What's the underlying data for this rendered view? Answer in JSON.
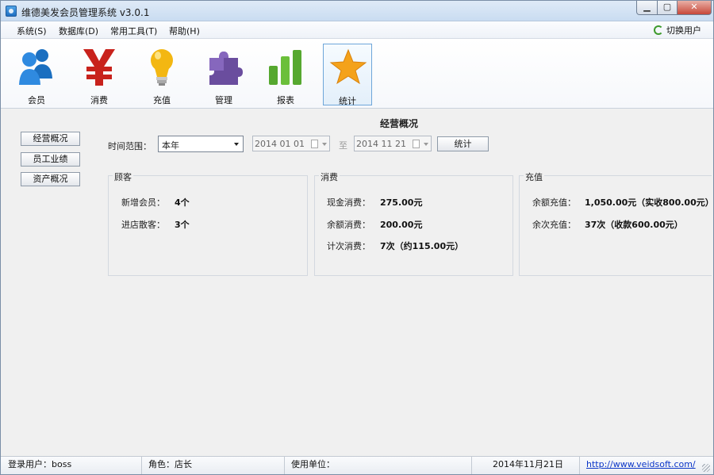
{
  "window": {
    "title": "维德美发会员管理系统 v3.0.1"
  },
  "menu": {
    "items": [
      {
        "label": "系统(S)"
      },
      {
        "label": "数据库(D)"
      },
      {
        "label": "常用工具(T)"
      },
      {
        "label": "帮助(H)"
      }
    ],
    "switch_user": "切换用户"
  },
  "toolbar": {
    "items": [
      {
        "label": "会员",
        "icon": "members-icon"
      },
      {
        "label": "消费",
        "icon": "yen-icon"
      },
      {
        "label": "充值",
        "icon": "lightbulb-icon"
      },
      {
        "label": "管理",
        "icon": "puzzle-icon"
      },
      {
        "label": "报表",
        "icon": "bar-chart-icon"
      },
      {
        "label": "统计",
        "icon": "star-icon",
        "active": true
      }
    ]
  },
  "sidebar": {
    "items": [
      {
        "label": "经营概况"
      },
      {
        "label": "员工业绩"
      },
      {
        "label": "资产概况"
      }
    ]
  },
  "main": {
    "title": "经营概况",
    "filter": {
      "range_label": "时间范围：",
      "range_value": "本年",
      "start_date": "2014 01 01",
      "to_label": "至",
      "end_date": "2014 11 21",
      "stat_button": "统计"
    },
    "panels": {
      "customers": {
        "title": "顾客",
        "rows": [
          {
            "label": "新增会员：",
            "value": "4个"
          },
          {
            "label": "进店散客：",
            "value": "3个"
          }
        ]
      },
      "consumption": {
        "title": "消费",
        "rows": [
          {
            "label": "现金消费：",
            "value": "275.00元"
          },
          {
            "label": "余额消费：",
            "value": "200.00元"
          },
          {
            "label": "计次消费：",
            "value": "7次（约115.00元）"
          }
        ]
      },
      "recharge": {
        "title": "充值",
        "rows": [
          {
            "label": "余额充值：",
            "value": "1,050.00元（实收800.00元）"
          },
          {
            "label": "余次充值：",
            "value": "37次（收款600.00元）"
          }
        ]
      }
    }
  },
  "statusbar": {
    "login_user": "登录用户：boss",
    "role": "角色：店长",
    "unit": "使用单位：",
    "date": "2014年11月21日",
    "website": "http://www.veidsoft.com/"
  },
  "colors": {
    "accent": "#1f6fc2",
    "link": "#0b36c8",
    "close": "#c7483a"
  }
}
